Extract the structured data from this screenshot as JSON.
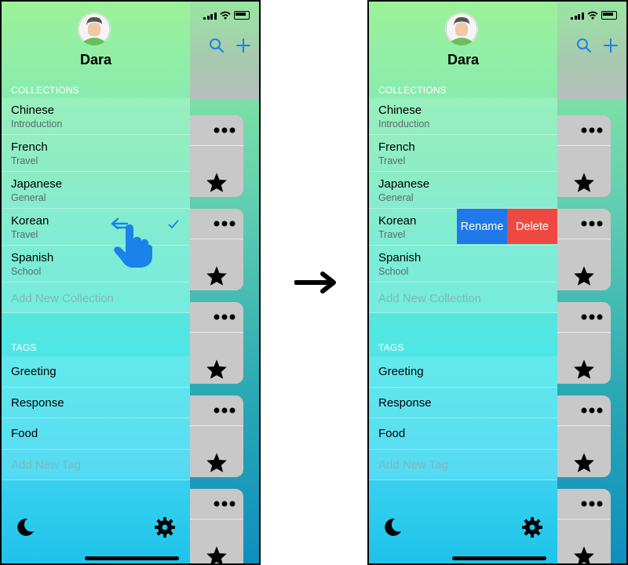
{
  "user": {
    "name": "Dara"
  },
  "sections": {
    "collections_label": "COLLECTIONS",
    "tags_label": "TAGS"
  },
  "collections": [
    {
      "title": "Chinese",
      "subtitle": "Introduction"
    },
    {
      "title": "French",
      "subtitle": "Travel"
    },
    {
      "title": "Japanese",
      "subtitle": "General"
    },
    {
      "title": "Korean",
      "subtitle": "Travel"
    },
    {
      "title": "Spanish",
      "subtitle": "School"
    }
  ],
  "add_collection_label": "Add New Collection",
  "tags": [
    "Greeting",
    "Response",
    "Food"
  ],
  "add_tag_label": "Add New Tag",
  "swipe_actions": {
    "rename": "Rename",
    "delete": "Delete"
  },
  "selected_collection": "Korean",
  "icons": {
    "search": "search-icon",
    "add": "plus-icon",
    "more": "more-dots-icon",
    "favorite": "star-icon",
    "dark_mode": "moon-icon",
    "settings": "gear-icon",
    "selected": "checkmark-icon",
    "gesture": "swipe-left-hand-icon",
    "transition": "right-arrow-icon"
  },
  "colors": {
    "rename": "#1f79e8",
    "delete": "#ee4940",
    "accent": "#1a82e8"
  }
}
